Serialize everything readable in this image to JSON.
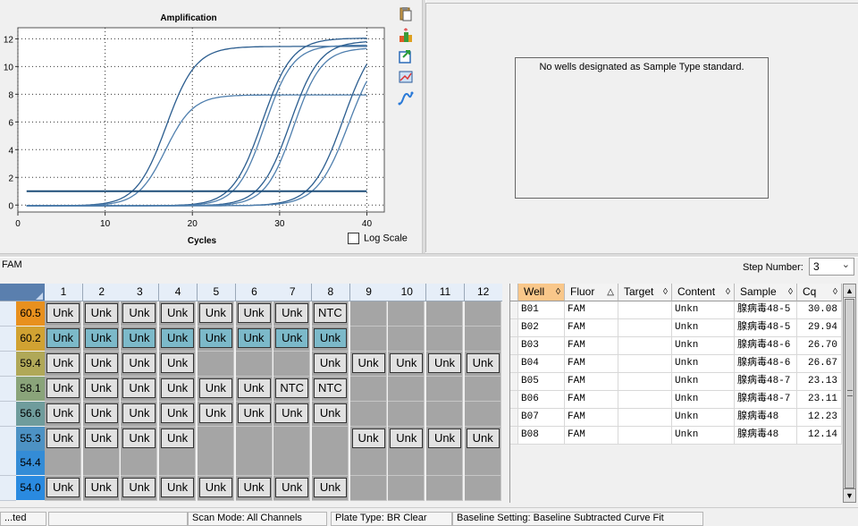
{
  "chart_data": {
    "type": "line",
    "title": "Amplification",
    "xlabel": "Cycles",
    "ylabel": "",
    "xlim": [
      0,
      42
    ],
    "ylim": [
      -0.5,
      12.8
    ],
    "x_ticks": [
      0,
      10,
      20,
      30,
      40
    ],
    "y_ticks": [
      0,
      2,
      4,
      6,
      8,
      10,
      12
    ],
    "grid": true,
    "threshold": 1.0,
    "series": [
      {
        "values_desc": "sigmoid",
        "plateau": 11.5,
        "midpoint": 17.0,
        "slope": 1.7
      },
      {
        "values_desc": "sigmoid",
        "plateau": 8.0,
        "midpoint": 16.9,
        "slope": 1.6
      },
      {
        "values_desc": "sigmoid",
        "plateau": 12.1,
        "midpoint": 28.0,
        "slope": 1.7
      },
      {
        "values_desc": "sigmoid",
        "plateau": 11.6,
        "midpoint": 28.3,
        "slope": 1.6
      },
      {
        "values_desc": "sigmoid",
        "plateau": 11.9,
        "midpoint": 31.2,
        "slope": 1.7
      },
      {
        "values_desc": "sigmoid",
        "plateau": 11.4,
        "midpoint": 31.6,
        "slope": 1.6
      },
      {
        "values_desc": "sigmoid",
        "plateau": 12.5,
        "midpoint": 37.3,
        "slope": 1.8
      },
      {
        "values_desc": "sigmoid",
        "plateau": 11.8,
        "midpoint": 37.9,
        "slope": 1.8
      }
    ]
  },
  "chart_panel": {
    "log_scale_label": "Log Scale",
    "icons": [
      "copy-icon",
      "export-icon",
      "report-icon",
      "chart-settings-icon",
      "curve-icon"
    ]
  },
  "standard_curve_panel": {
    "message": "No wells designated as Sample Type standard."
  },
  "fluor_label": "FAM",
  "step_number": {
    "label": "Step Number:",
    "value": "3"
  },
  "plate": {
    "columns": [
      "1",
      "2",
      "3",
      "4",
      "5",
      "6",
      "7",
      "8",
      "9",
      "10",
      "11",
      "12"
    ],
    "rows": [
      {
        "temp": "60.5",
        "temp_color": "#e8901e",
        "wells": [
          "Unk",
          "Unk",
          "Unk",
          "Unk",
          "Unk",
          "Unk",
          "Unk",
          "NTC",
          "",
          "",
          "",
          ""
        ]
      },
      {
        "temp": "60.2",
        "temp_color": "#d1a232",
        "selected": true,
        "wells": [
          "Unk",
          "Unk",
          "Unk",
          "Unk",
          "Unk",
          "Unk",
          "Unk",
          "Unk",
          "",
          "",
          "",
          ""
        ]
      },
      {
        "temp": "59.4",
        "temp_color": "#b0a858",
        "wells": [
          "Unk",
          "Unk",
          "Unk",
          "Unk",
          "",
          "",
          "",
          "Unk",
          "Unk",
          "Unk",
          "Unk",
          "Unk"
        ]
      },
      {
        "temp": "58.1",
        "temp_color": "#8aa47a",
        "wells": [
          "Unk",
          "Unk",
          "Unk",
          "Unk",
          "Unk",
          "Unk",
          "NTC",
          "NTC",
          "",
          "",
          "",
          ""
        ]
      },
      {
        "temp": "56.6",
        "temp_color": "#6f9c9c",
        "wells": [
          "Unk",
          "Unk",
          "Unk",
          "Unk",
          "Unk",
          "Unk",
          "Unk",
          "Unk",
          "",
          "",
          "",
          ""
        ]
      },
      {
        "temp": "55.3",
        "temp_color": "#4d92c4",
        "wells": [
          "Unk",
          "Unk",
          "Unk",
          "Unk",
          "",
          "",
          "",
          "",
          "Unk",
          "Unk",
          "Unk",
          "Unk"
        ]
      },
      {
        "temp": "54.4",
        "temp_color": "#348cd6",
        "wells": [
          "",
          "",
          "",
          "",
          "",
          "",
          "",
          "",
          "",
          "",
          "",
          ""
        ]
      },
      {
        "temp": "54.0",
        "temp_color": "#2a8ae0",
        "wells": [
          "Unk",
          "Unk",
          "Unk",
          "Unk",
          "Unk",
          "Unk",
          "Unk",
          "Unk",
          "",
          "",
          "",
          ""
        ]
      }
    ]
  },
  "results_table": {
    "headers": [
      "Well",
      "Fluor",
      "Target",
      "Content",
      "Sample",
      "Cq"
    ],
    "sort_marks": [
      "◊",
      "△",
      "◊",
      "◊",
      "◊",
      "◊"
    ],
    "rows": [
      [
        "B01",
        "FAM",
        "",
        "Unkn",
        "腺病毒48-5",
        "30.08"
      ],
      [
        "B02",
        "FAM",
        "",
        "Unkn",
        "腺病毒48-5",
        "29.94"
      ],
      [
        "B03",
        "FAM",
        "",
        "Unkn",
        "腺病毒48-6",
        "26.70"
      ],
      [
        "B04",
        "FAM",
        "",
        "Unkn",
        "腺病毒48-6",
        "26.67"
      ],
      [
        "B05",
        "FAM",
        "",
        "Unkn",
        "腺病毒48-7",
        "23.13"
      ],
      [
        "B06",
        "FAM",
        "",
        "Unkn",
        "腺病毒48-7",
        "23.11"
      ],
      [
        "B07",
        "FAM",
        "",
        "Unkn",
        "腺病毒48",
        "12.23"
      ],
      [
        "B08",
        "FAM",
        "",
        "Unkn",
        "腺病毒48",
        "12.14"
      ]
    ]
  },
  "status_bar": {
    "items": [
      "...ted",
      "",
      "Scan Mode: All Channels",
      "Plate Type: BR Clear",
      "Baseline Setting: Baseline Subtracted Curve Fit"
    ]
  },
  "colors": {
    "curve": "#2b5d8f",
    "threshold": "#1f4e79",
    "selected_well": "#7cb9c9",
    "empty_well": "#a5a5a5"
  }
}
